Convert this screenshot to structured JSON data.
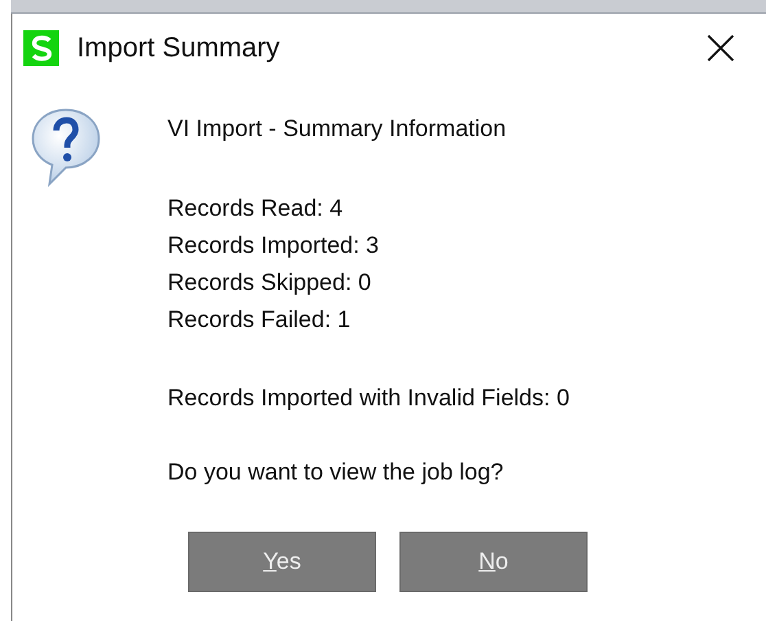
{
  "window": {
    "title": "Import Summary"
  },
  "heading": "VI Import - Summary Information",
  "stats": [
    "Records Read: 4",
    "Records Imported: 3",
    "Records Skipped: 0",
    "Records Failed: 1"
  ],
  "invalid_fields": "Records Imported with Invalid Fields: 0",
  "question": "Do you want to view the job log?",
  "buttons": [
    "Yes",
    "No"
  ]
}
